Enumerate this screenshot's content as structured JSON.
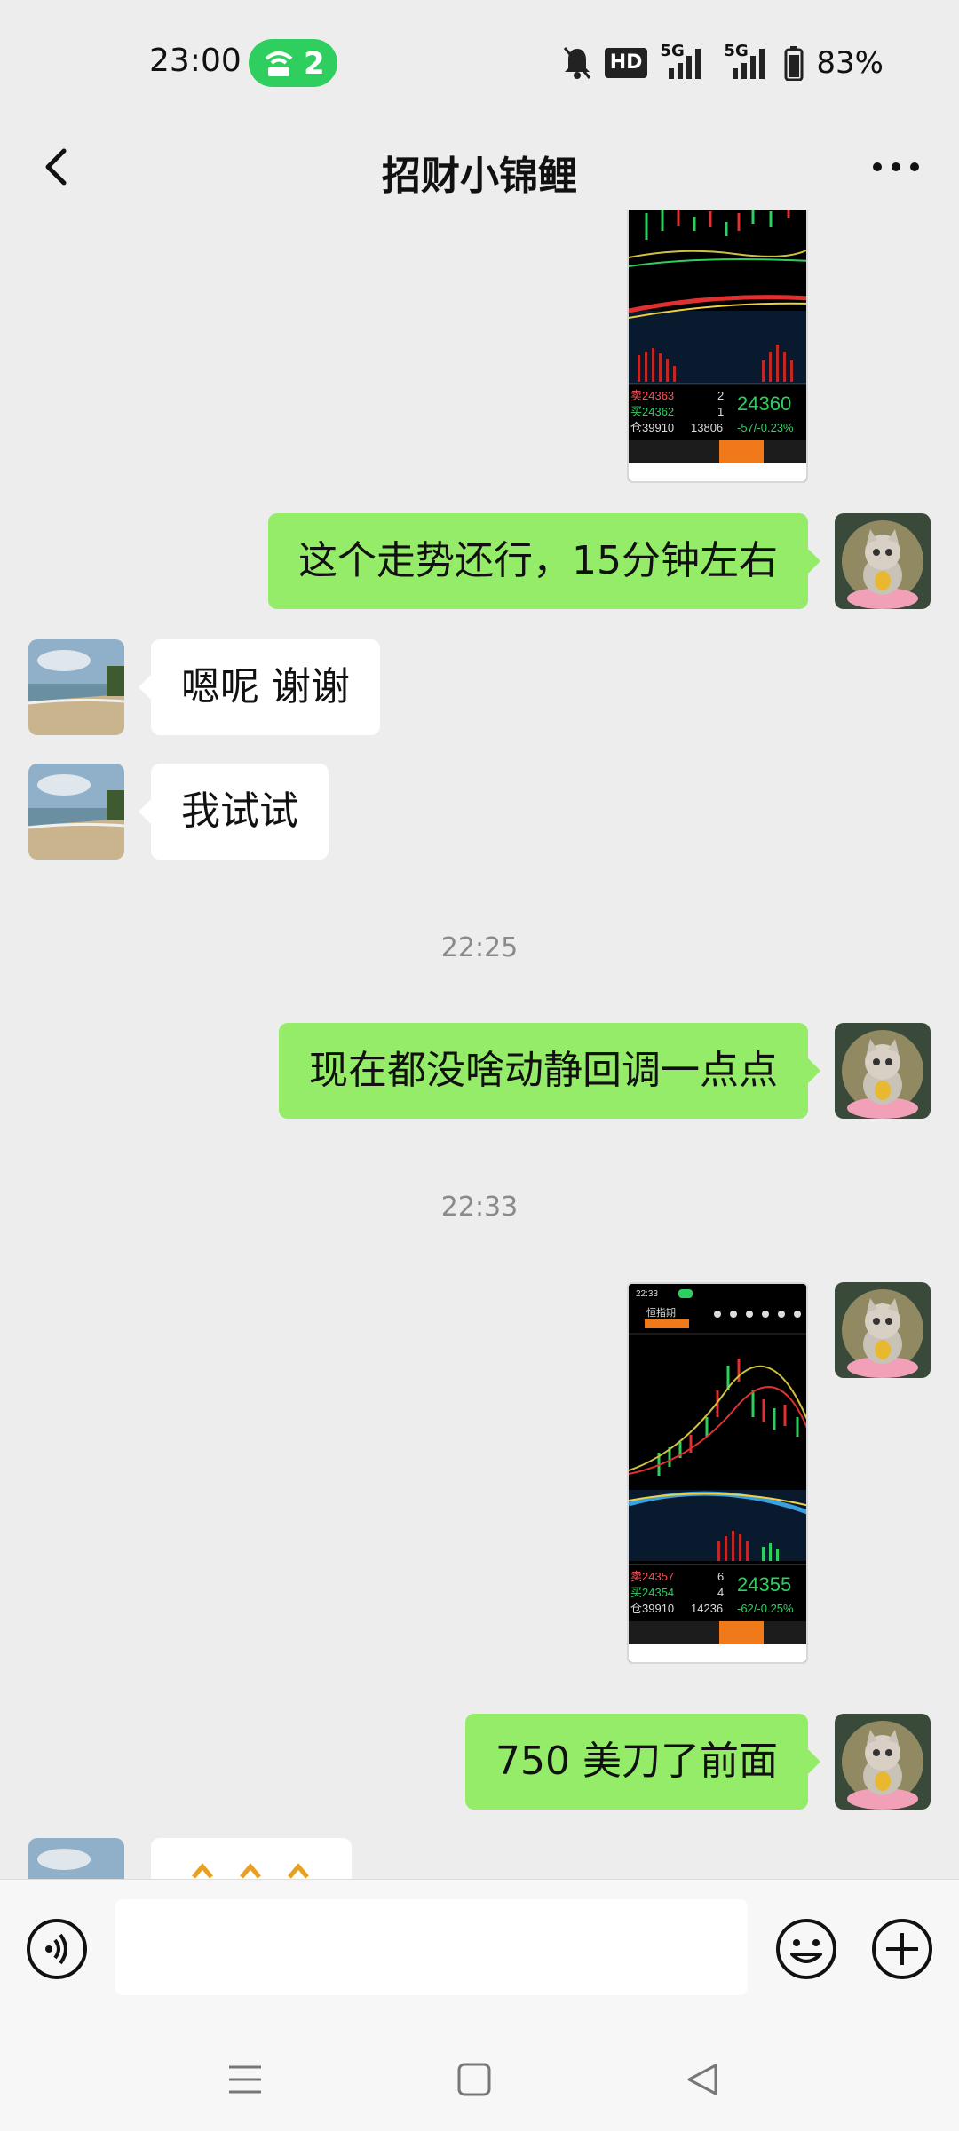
{
  "status": {
    "time": "23:00",
    "hotspot_count": "2",
    "hd_label": "HD",
    "net1": "5G",
    "net2": "5G",
    "battery": "83%"
  },
  "nav": {
    "title": "招财小锦鲤",
    "back_icon": "chevron-left-icon",
    "more_icon": "more-dots-icon"
  },
  "messages": {
    "m1": "这个走势还行，15分钟左右",
    "m2": "嗯呢 谢谢",
    "m3": "我试试",
    "t1": "22:25",
    "m4": "现在都没啥动静回调一点点",
    "t2": "22:33",
    "m5": "750 美刀了前面"
  },
  "screenshot1": {
    "sell_label": "卖24363",
    "sell_qty": "2",
    "buy_label": "买24362",
    "buy_qty": "1",
    "hold_label": "仓39910",
    "hold_qty": "13806",
    "price": "24360",
    "change": "-57/-0.23%"
  },
  "screenshot2": {
    "header_time": "22:33",
    "title": "恒指期",
    "sell_label": "卖24357",
    "sell_qty": "6",
    "buy_label": "买24354",
    "buy_qty": "4",
    "hold_label": "仓39910",
    "hold_qty": "14236",
    "price": "24355",
    "change": "-62/-0.25%"
  },
  "input": {
    "placeholder": ""
  },
  "colors": {
    "my_bubble": "#95ec69",
    "other_bubble": "#ffffff",
    "background": "#ededed",
    "up": "#2fcf5f",
    "down": "#e03030"
  }
}
